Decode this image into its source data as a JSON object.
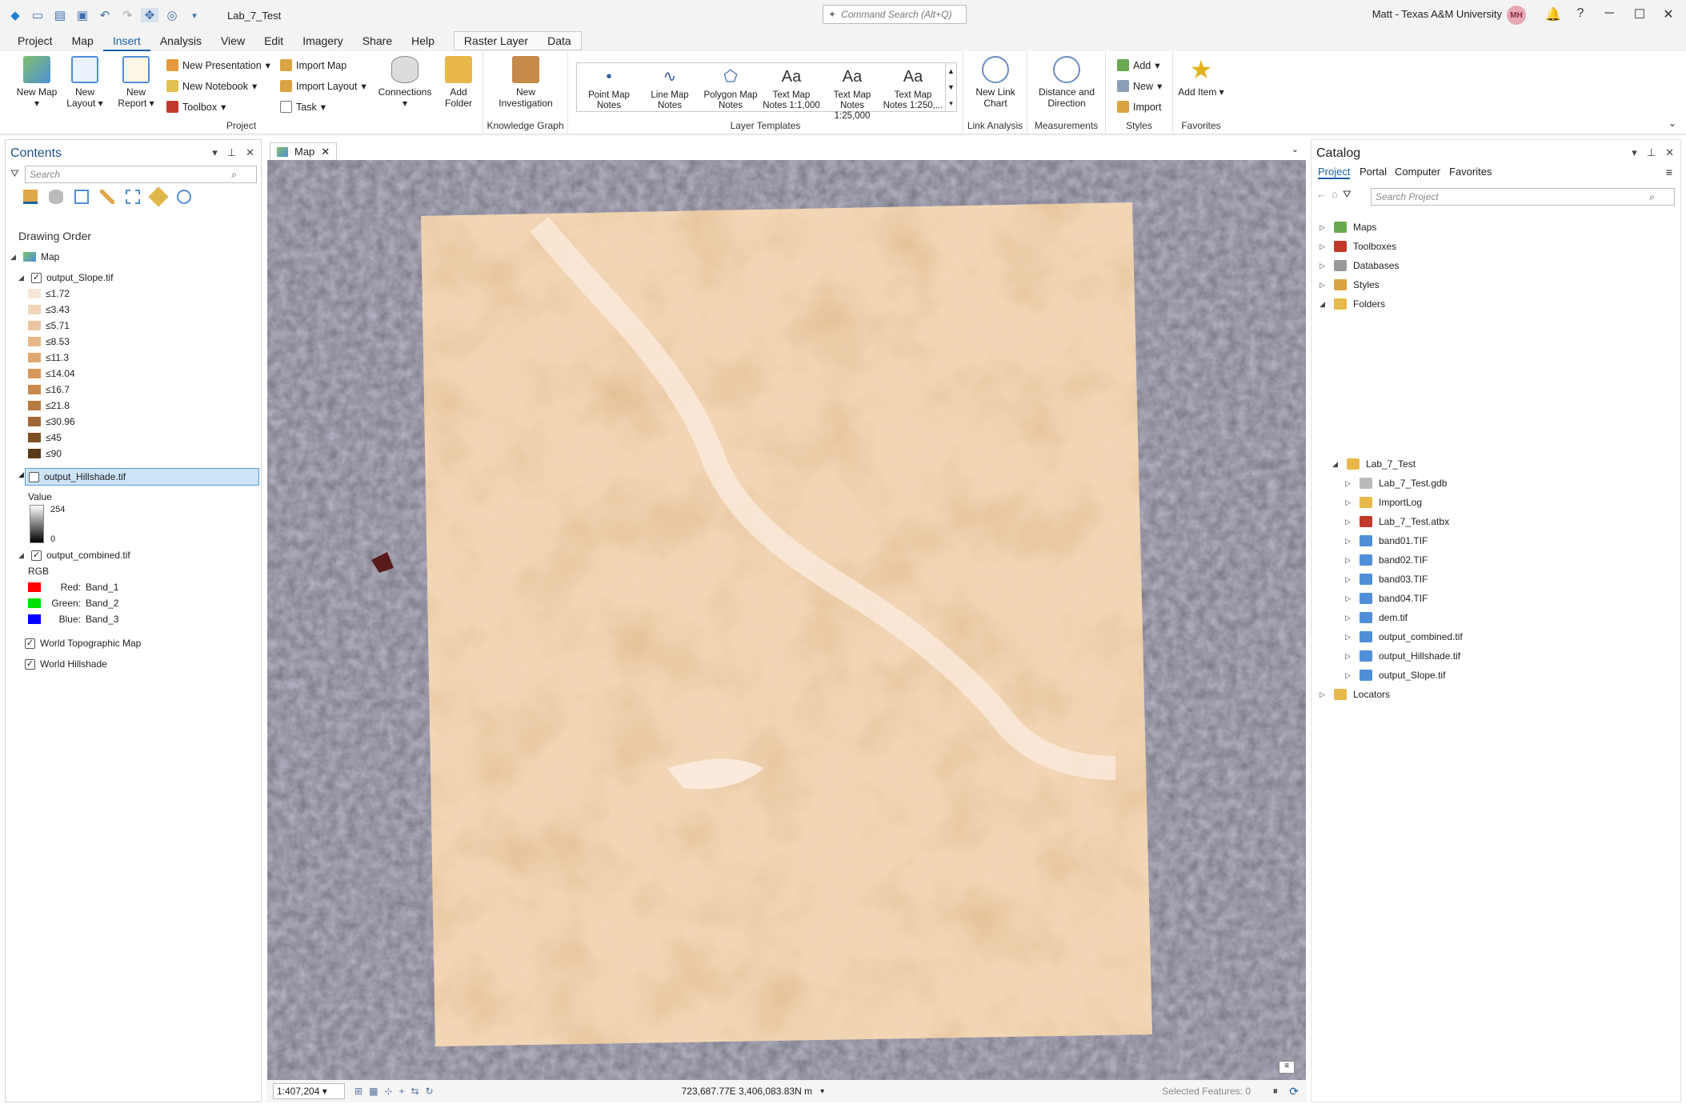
{
  "titlebar": {
    "project": "Lab_7_Test",
    "command_search": "Command Search (Alt+Q)",
    "user": "Matt - Texas A&M University",
    "avatar": "MH"
  },
  "menu": [
    "Project",
    "Map",
    "Insert",
    "Analysis",
    "View",
    "Edit",
    "Imagery",
    "Share",
    "Help"
  ],
  "active_menu": "Insert",
  "context_tabs": [
    "Raster Layer",
    "Data"
  ],
  "ribbon": {
    "project_group": {
      "label": "Project",
      "new_map": "New Map",
      "new_layout": "New Layout",
      "new_report": "New Report",
      "new_presentation": "New Presentation",
      "new_notebook": "New Notebook",
      "toolbox": "Toolbox",
      "import_map": "Import Map",
      "import_layout": "Import Layout",
      "task": "Task",
      "connections": "Connections",
      "add_folder": "Add Folder"
    },
    "kg_group": {
      "label": "Knowledge Graph",
      "new_investigation": "New Investigation"
    },
    "templates_group": {
      "label": "Layer Templates",
      "items": [
        "Point Map Notes",
        "Line Map Notes",
        "Polygon Map Notes",
        "Text Map Notes 1:1,000",
        "Text Map Notes 1:25,000",
        "Text Map Notes 1:250,..."
      ]
    },
    "link_group": {
      "label": "Link Analysis",
      "new_link_chart": "New Link Chart"
    },
    "meas_group": {
      "label": "Measurements",
      "distance": "Distance and Direction"
    },
    "styles_group": {
      "label": "Styles",
      "add": "Add",
      "new": "New",
      "import": "Import"
    },
    "fav_group": {
      "label": "Favorites",
      "add_item": "Add Item"
    }
  },
  "contents": {
    "title": "Contents",
    "search_placeholder": "Search",
    "drawing_order": "Drawing Order",
    "map_label": "Map",
    "slope_layer": "output_Slope.tif",
    "slope_classes": [
      "≤1.72",
      "≤3.43",
      "≤5.71",
      "≤8.53",
      "≤11.3",
      "≤14.04",
      "≤16.7",
      "≤21.8",
      "≤30.96",
      "≤45",
      "≤90"
    ],
    "slope_colors": [
      "#f7e7d8",
      "#f1d5b8",
      "#ecc6a0",
      "#e6b888",
      "#e0a870",
      "#d7975a",
      "#c98a4c",
      "#b97a40",
      "#a06734",
      "#7d5023",
      "#5c3a17"
    ],
    "hillshade_layer": "output_Hillshade.tif",
    "value_label": "Value",
    "value_high": "254",
    "value_low": "0",
    "combined_layer": "output_combined.tif",
    "rgb_label": "RGB",
    "bands": [
      {
        "name": "Red:",
        "band": "Band_1",
        "color": "#ff0000"
      },
      {
        "name": "Green:",
        "band": "Band_2",
        "color": "#00e000"
      },
      {
        "name": "Blue:",
        "band": "Band_3",
        "color": "#0000ff"
      }
    ],
    "basemaps": [
      "World Topographic Map",
      "World Hillshade"
    ]
  },
  "map": {
    "tab": "Map",
    "scale": "1:407,204",
    "coords": "723,687.77E 3,406,083.83N m",
    "selected": "Selected Features: 0"
  },
  "catalog": {
    "title": "Catalog",
    "tabs": [
      "Project",
      "Portal",
      "Computer",
      "Favorites"
    ],
    "search_placeholder": "Search Project",
    "top_items": [
      "Maps",
      "Toolboxes",
      "Databases",
      "Styles",
      "Folders"
    ],
    "folder": "Lab_7_Test",
    "folder_items": [
      "Lab_7_Test.gdb",
      "ImportLog",
      "Lab_7_Test.atbx",
      "band01.TIF",
      "band02.TIF",
      "band03.TIF",
      "band04.TIF",
      "dem.tif",
      "output_combined.tif",
      "output_Hillshade.tif",
      "output_Slope.tif"
    ],
    "locators": "Locators"
  }
}
